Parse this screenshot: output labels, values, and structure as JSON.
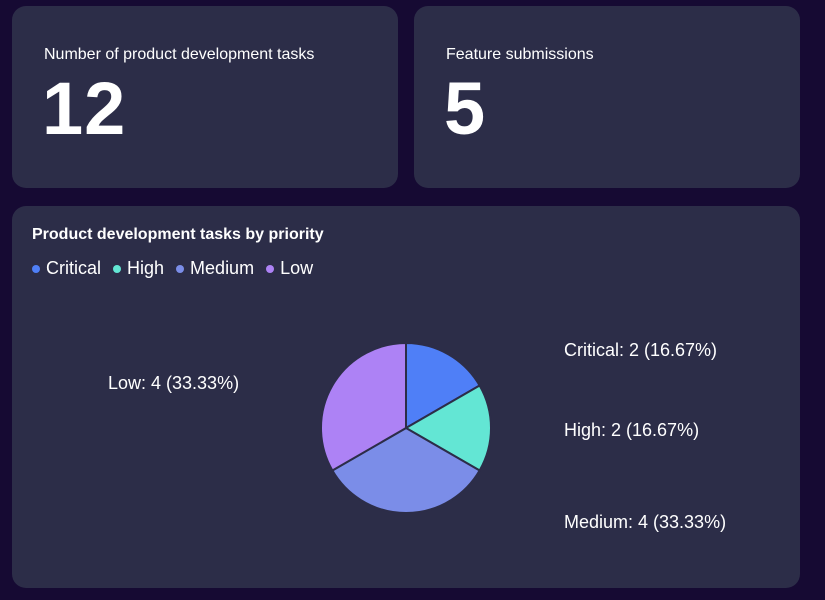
{
  "kpis": [
    {
      "label": "Number of product development tasks",
      "value": "12"
    },
    {
      "label": "Feature submissions",
      "value": "5"
    }
  ],
  "chart_data": {
    "type": "pie",
    "title": "Product development tasks by priority",
    "legend_position": "top-left",
    "categories": [
      "Critical",
      "High",
      "Medium",
      "Low"
    ],
    "values": [
      2,
      2,
      4,
      4
    ],
    "labels": [
      "Critical: 2 (16.67%)",
      "High: 2 (16.67%)",
      "Medium: 4 (33.33%)",
      "Low: 4 (33.33%)"
    ],
    "colors": [
      "#4f7ff7",
      "#63e6d4",
      "#7b8de8",
      "#ad82f5"
    ]
  }
}
